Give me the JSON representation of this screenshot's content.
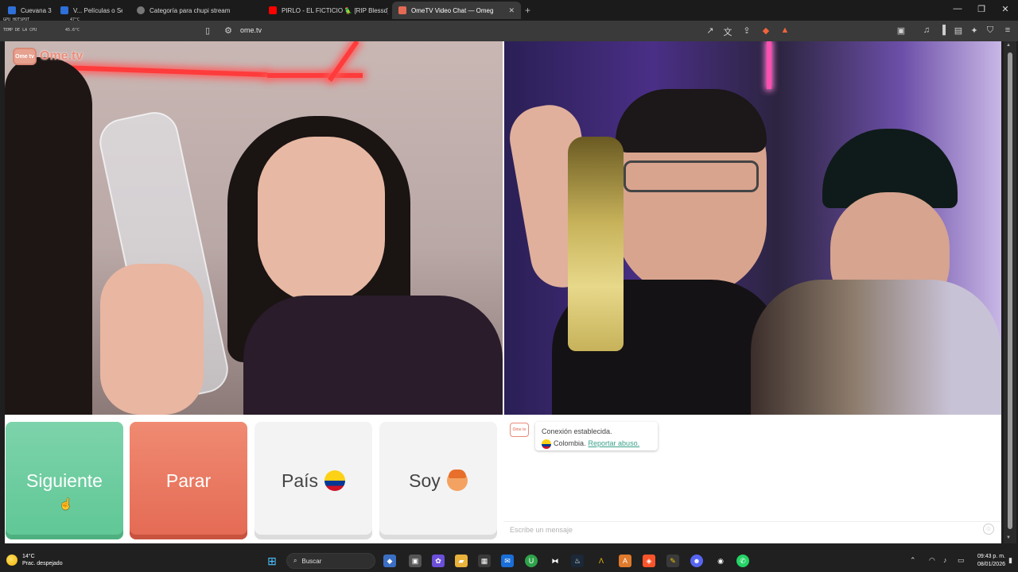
{
  "tabs": [
    {
      "title": "Cuevana 3",
      "color": "#2e6fd8"
    },
    {
      "title": "V... Películas o Series",
      "color": "#2e6fd8"
    },
    {
      "title": "Categoría para chupi stream",
      "color": "#888888"
    },
    {
      "title": "PIRLO - EL FICTICIO 🦜 [RIP Blessd]",
      "color": "#ff0000"
    },
    {
      "title": "OmeTV Video Chat — Omeg",
      "color": "#e46a54"
    }
  ],
  "sensors": [
    {
      "label": "GPU HOTSPOT",
      "value": "47°C"
    },
    {
      "label": "TEMP DE LA CPU",
      "value": "45.6°C"
    }
  ],
  "address": {
    "url": "ome.tv"
  },
  "site": {
    "logo_box": "Ome tv",
    "logo_text": "Ome.tv"
  },
  "controls": {
    "next": "Siguiente",
    "stop": "Parar",
    "country": "País",
    "gender": "Soy"
  },
  "chat": {
    "logo": "Ome tv",
    "status": "Conexión establecida.",
    "country": "Colombia.",
    "report": "Reportar abuso.",
    "placeholder": "Escribe un mensaje"
  },
  "taskbar": {
    "temperature": "14°C",
    "weather": "Prac. despejado",
    "search": "Buscar",
    "time": "09:43 p. m.",
    "date": "08/01/2026"
  },
  "colors": {
    "next_button": "#6fcf9f",
    "stop_button": "#e8735b",
    "link": "#3aa189",
    "brand": "#ec8d79"
  }
}
